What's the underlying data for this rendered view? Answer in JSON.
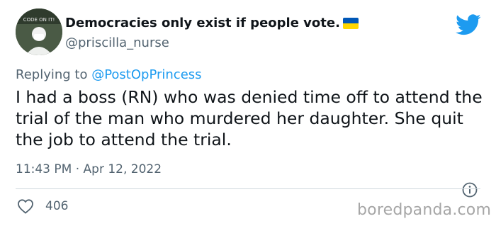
{
  "author": {
    "display_name": "Democracies only exist if people vote.",
    "handle": "@priscilla_nurse",
    "avatar_text": "CODE ON IT!"
  },
  "icons": {
    "flag": "ukraine-flag-icon",
    "logo": "twitter-bird-icon",
    "info": "info-icon",
    "like": "heart-icon"
  },
  "reply": {
    "prefix": "Replying to ",
    "mention": "@PostOpPrincess"
  },
  "tweet": {
    "text": "I had a boss (RN) who was denied time off to attend the trial of the man who murdered her daughter. She quit the job to attend the trial.",
    "timestamp": "11:43 PM · Apr 12, 2022",
    "likes": "406"
  },
  "watermark": "boredpanda.com",
  "colors": {
    "brand_blue": "#1d9bf0",
    "muted_text": "#536471",
    "flag_blue": "#0057b7",
    "flag_yellow": "#ffd700"
  }
}
